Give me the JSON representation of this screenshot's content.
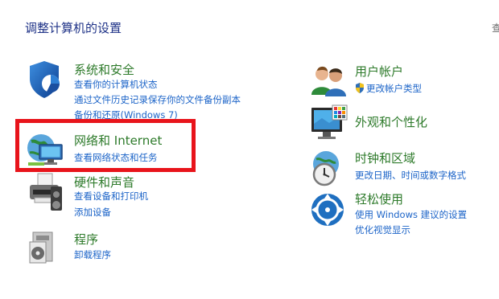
{
  "page": {
    "title": "调整计算机的设置",
    "view_by": "查"
  },
  "left": [
    {
      "id": "system-security",
      "heading": "系统和安全",
      "icon": "shield-icon",
      "links": [
        "查看你的计算机状态",
        "通过文件历史记录保存你的文件备份副本",
        "备份和还原(Windows 7)"
      ]
    },
    {
      "id": "network-internet",
      "heading": "网络和 Internet",
      "icon": "network-icon",
      "links": [
        "查看网络状态和任务"
      ]
    },
    {
      "id": "hardware-sound",
      "heading": "硬件和声音",
      "icon": "printer-icon",
      "links": [
        "查看设备和打印机",
        "添加设备"
      ]
    },
    {
      "id": "programs",
      "heading": "程序",
      "icon": "programs-icon",
      "links": [
        "卸载程序"
      ]
    }
  ],
  "right": [
    {
      "id": "user-accounts",
      "heading": "用户帐户",
      "icon": "users-icon",
      "links": [
        "更改帐户类型"
      ]
    },
    {
      "id": "appearance",
      "heading": "外观和个性化",
      "icon": "monitor-icon",
      "links": []
    },
    {
      "id": "clock-region",
      "heading": "时钟和区域",
      "icon": "clock-globe-icon",
      "links": [
        "更改日期、时间或数字格式"
      ]
    },
    {
      "id": "ease-of-access",
      "heading": "轻松使用",
      "icon": "ease-of-access-icon",
      "links": [
        "使用 Windows 建议的设置",
        "优化视觉显示"
      ]
    }
  ],
  "colors": {
    "heading": "#2d7a2a",
    "link": "#1c64c8",
    "title": "#1e3287",
    "highlight": "#e8141b"
  }
}
